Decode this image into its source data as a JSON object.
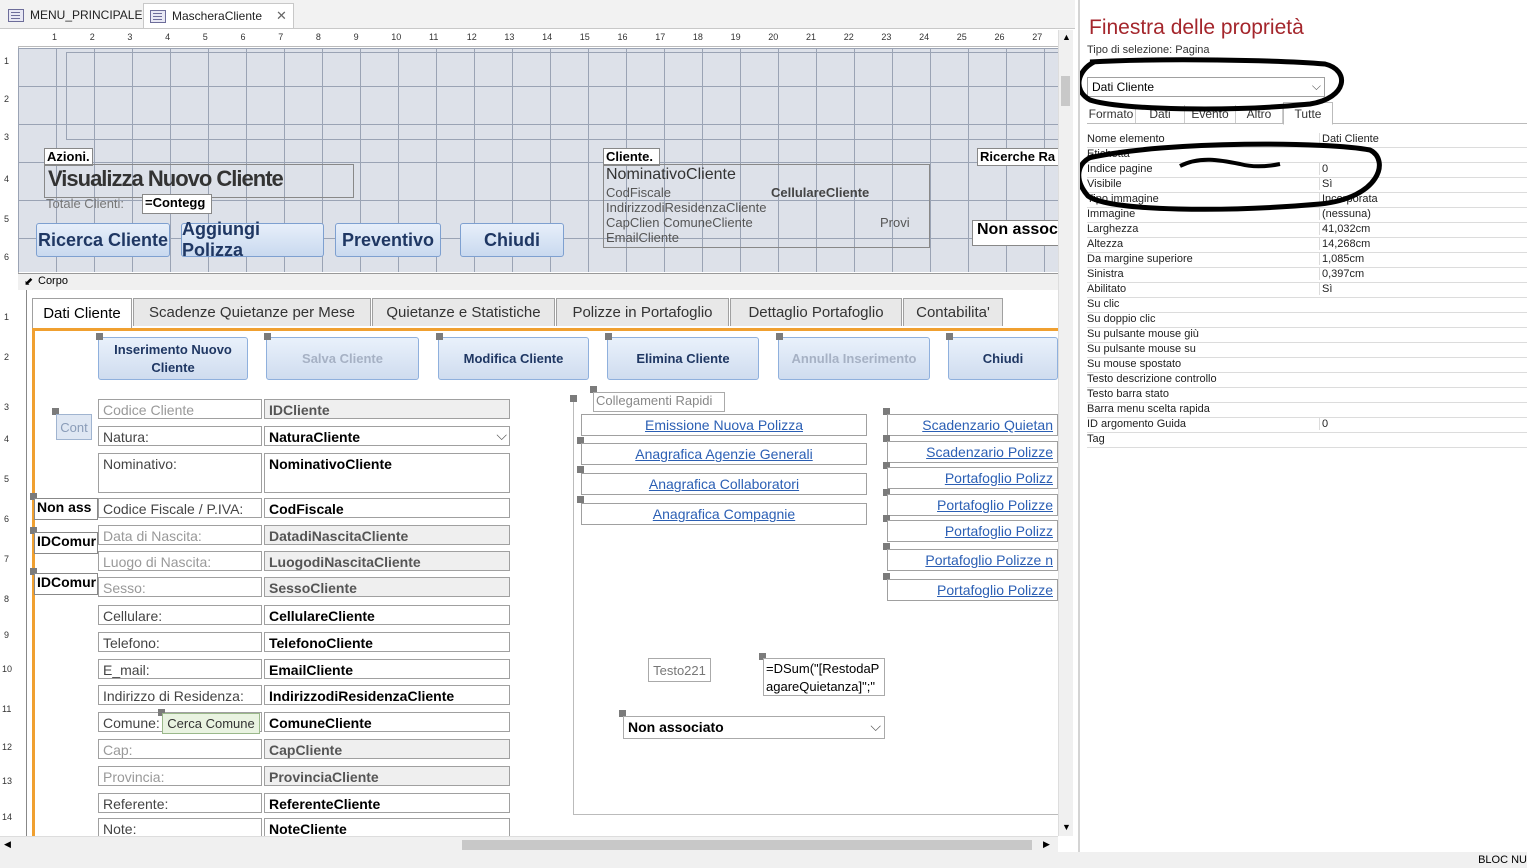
{
  "doc_tabs": [
    {
      "label": "MENU_PRINCIPALE"
    },
    {
      "label": "MascheraCliente"
    }
  ],
  "ruler_top": [
    "1",
    "2",
    "3",
    "4",
    "5",
    "6",
    "7",
    "8",
    "9",
    "10",
    "11",
    "12",
    "13",
    "14",
    "15",
    "16",
    "17",
    "18",
    "19",
    "20",
    "21",
    "22",
    "23",
    "24",
    "25",
    "26",
    "27"
  ],
  "header": {
    "azioni_label": "Azioni.",
    "overlap_text": "Visualizza Nuovo Cliente",
    "totale_label": "Totale Clienti:",
    "totale_value": "=Contegg",
    "btn_ricerca": "Ricerca Cliente",
    "btn_aggiungi": "Aggiungi Polizza",
    "btn_preventivo": "Preventivo",
    "btn_chiudi": "Chiudi",
    "cliente_label": "Cliente.",
    "nominativo": "NominativoCliente",
    "codfiscale": "CodFiscale",
    "cellulare": "CellulareCliente",
    "indirizzo": "IndirizzodiResidenzaCliente",
    "cap_comune": "CapClien ComuneCliente",
    "provi": "Provi",
    "email": "EmailCliente",
    "ricerche": "Ricerche Ra",
    "non_assoc": "Non assoc"
  },
  "corpo_label": "Corpo",
  "tabs": [
    {
      "label": "Dati Cliente"
    },
    {
      "label": "Scadenze Quietanze per Mese"
    },
    {
      "label": "Quietanze e Statistiche"
    },
    {
      "label": "Polizze in Portafoglio"
    },
    {
      "label": "Dettaglio Portafoglio"
    },
    {
      "label": "Contabilita'"
    }
  ],
  "actions": {
    "inserimento": "Inserimento Nuovo Cliente",
    "salva": "Salva Cliente",
    "modifica": "Modifica Cliente",
    "elimina": "Elimina Cliente",
    "annulla": "Annulla Inserimento",
    "chiudi": "Chiudi"
  },
  "left_side": {
    "cont": "Cont",
    "non_ass": "Non ass",
    "idcomur1": "IDComur",
    "idcomur2": "IDComur"
  },
  "fields": [
    {
      "label": "Codice Cliente",
      "value": "IDCliente"
    },
    {
      "label": "Natura:",
      "value": "NaturaCliente"
    },
    {
      "label": "Nominativo:",
      "value": "NominativoCliente"
    },
    {
      "label": "Codice Fiscale / P.IVA:",
      "value": "CodFiscale"
    },
    {
      "label": "Data di Nascita:",
      "value": "DatadiNascitaCliente"
    },
    {
      "label": "Luogo di Nascita:",
      "value": "LuogodiNascitaCliente"
    },
    {
      "label": "Sesso:",
      "value": "SessoCliente"
    },
    {
      "label": "Cellulare:",
      "value": "CellulareCliente"
    },
    {
      "label": "Telefono:",
      "value": "TelefonoCliente"
    },
    {
      "label": "E_mail:",
      "value": "EmailCliente"
    },
    {
      "label": "Indirizzo di Residenza:",
      "value": "IndirizzodiResidenzaCliente"
    },
    {
      "label": "Comune:",
      "value": "ComuneCliente"
    },
    {
      "label": "Cap:",
      "value": "CapCliente"
    },
    {
      "label": "Provincia:",
      "value": "ProvinciaCliente"
    },
    {
      "label": "Referente:",
      "value": "ReferenteCliente"
    },
    {
      "label": "Note:",
      "value": "NoteCliente"
    }
  ],
  "cerca_comune": "Cerca Comune",
  "collegamenti": {
    "title": "Collegamenti Rapidi",
    "left": [
      "Emissione Nuova Polizza",
      "Anagrafica Agenzie Generali",
      "Anagrafica Collaboratori",
      "Anagrafica Compagnie"
    ],
    "right": [
      "Scadenzario Quietan",
      "Scadenzario Polizze",
      "Portafoglio Polizz",
      "Portafoglio Polizze",
      "Portafoglio Polizz",
      "Portafoglio Polizze n",
      "Portafoglio Polizze"
    ]
  },
  "testo221": "Testo221",
  "dsum": "=DSum(\"[RestodaPagareQuietanza]\";\"",
  "non_associato": "Non associato",
  "properties": {
    "title": "Finestra delle proprietà",
    "selection_type_label": "Tipo di selezione:",
    "selection_type_value": "Pagina",
    "combo_value": "Dati Cliente",
    "tabs": [
      "Formato",
      "Dati",
      "Evento",
      "Altro",
      "Tutte"
    ],
    "rows": [
      {
        "name": "Nome elemento",
        "value": "Dati Cliente"
      },
      {
        "name": "Etichetta",
        "value": ""
      },
      {
        "name": "Indice pagine",
        "value": "0"
      },
      {
        "name": "Visibile",
        "value": "Sì"
      },
      {
        "name": "Tipo immagine",
        "value": "Incorporata"
      },
      {
        "name": "Immagine",
        "value": "(nessuna)"
      },
      {
        "name": "Larghezza",
        "value": "41,032cm"
      },
      {
        "name": "Altezza",
        "value": "14,268cm"
      },
      {
        "name": "Da margine superiore",
        "value": "1,085cm"
      },
      {
        "name": "Sinistra",
        "value": "0,397cm"
      },
      {
        "name": "Abilitato",
        "value": "Sì"
      },
      {
        "name": "Su clic",
        "value": ""
      },
      {
        "name": "Su doppio clic",
        "value": ""
      },
      {
        "name": "Su pulsante mouse giù",
        "value": ""
      },
      {
        "name": "Su pulsante mouse su",
        "value": ""
      },
      {
        "name": "Su mouse spostato",
        "value": ""
      },
      {
        "name": "Testo descrizione controllo",
        "value": ""
      },
      {
        "name": "Testo barra stato",
        "value": ""
      },
      {
        "name": "Barra menu scelta rapida",
        "value": ""
      },
      {
        "name": "ID argomento Guida",
        "value": "0"
      },
      {
        "name": "Tag",
        "value": ""
      }
    ]
  },
  "status_text": "BLOC NU"
}
